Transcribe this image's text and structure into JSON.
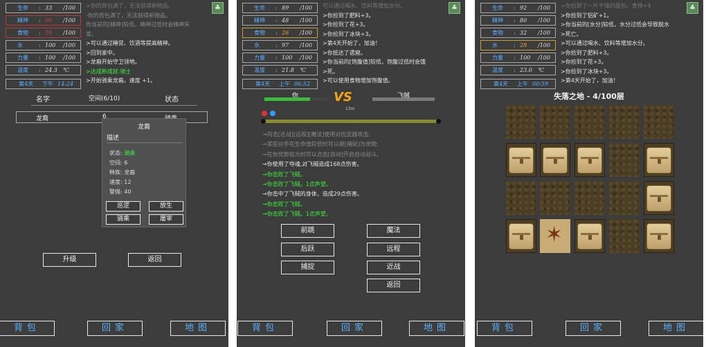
{
  "status": {
    "hp_label": "生命",
    "fresh_label": "精神",
    "food_label": "食物",
    "water_label": "水",
    "str_label": "力量",
    "temp_label": "温度",
    "sep": ":",
    "max": "/100",
    "deg": "℃"
  },
  "panel1": {
    "hp": "33",
    "fresh": "00",
    "food": "10",
    "water": "100",
    "str": "100",
    "temp": "24.3",
    "day": "第4天",
    "tod": "下午",
    "clock": "14:24",
    "log": [
      ">你的背包满了，无法获得新物品。",
      "-你的背包满了，无法获得新物品。",
      "你当前的[精神]较低，精神过低时会精神失",
      "常。",
      ">可以通过睡觉、饮酒等提高精神。",
      ">回到家中。",
      ">龙裔开始守卫领地。",
      ">达成新成就:骑士",
      ">开始骑乘龙裔。速度 +1。"
    ],
    "table_headers": {
      "name": "名字",
      "space": "空间(6/10)",
      "state": "状态"
    },
    "row": {
      "name": "龙裔",
      "space": "6",
      "state": "骑乘"
    },
    "popup": {
      "title": "龙裔",
      "desc": "描述",
      "state_k": "状态:",
      "state_v": "骑乘",
      "space_k": "空间:",
      "space_v": "6",
      "kind_k": "种族:",
      "kind_v": "龙裔",
      "speed_k": "速度:",
      "speed_v": "12",
      "loyal_k": "警惕:",
      "loyal_v": "40",
      "b1": "巡逻",
      "b2": "放生",
      "b3": "骑乘",
      "b4": "屠宰"
    },
    "upgrade": "升级",
    "back": "返回"
  },
  "panel2": {
    "hp": "89",
    "fresh": "48",
    "food": "26",
    "water": "97",
    "str": "100",
    "temp": "21.8",
    "day": "第4天",
    "tod": "上午",
    "clock": "06:52",
    "log": [
      "可以通过喝水、饮料等增加水分。",
      ">你捡到了肥料+3。",
      ">你捡到了花+3。",
      ">你捡到了冰块+3。",
      ">第4天开始了，加油！",
      ">你抵达了遗窟。",
      ">你当前的[饱腹值]较低，饱腹过低时会饿",
      ">死。",
      ">可以使用食物增加饱腹值。"
    ],
    "you": "你",
    "enemy": "飞贼",
    "vs": "VS",
    "distance": "13m",
    "combat": [
      "→向击[近战][远程][魔法]使用对应武器攻击;",
      "→某些对手在生命值较低时可以被[捕捉]为宠物;",
      "→在你优势较大时可以点击[自动]开启自动战斗。",
      "→你使用了夺魂,对飞贼造成168点伤害。",
      "→你击败了飞贼。",
      "→你击败了飞贼。1点声望。",
      "→你击中了飞贼的身体，造成29点伤害。",
      "→你击败了飞贼。",
      "→你击败了飞贼。1点声望。"
    ],
    "actions": {
      "a1": "前跳",
      "a2": "魔法",
      "a3": "后跃",
      "a4": "远程",
      "a5": "捕捉",
      "a6": "近战",
      "a7": "返回"
    }
  },
  "panel3": {
    "hp": "92",
    "fresh": "80",
    "food": "32",
    "water": "28",
    "str": "100",
    "temp": "23.0",
    "day": "第4天",
    "tod": "上午",
    "clock": "00:59",
    "log": [
      ">你捡到了一片干燥的面包。食物+4",
      ">你捡到了铝矿+1。",
      ">你当前的[水分]较低，水分过低会导致脱水",
      ">死亡。",
      ">可以通过喝水、饮料等增加水分。",
      ">你捡到了肥料+3。",
      ">你捡到了花+3。",
      ">你捡到了冰块+3。",
      ">第4天开始了，加油！"
    ],
    "title": "失落之地 - 4/100层",
    "grid": [
      [
        "dirt",
        "dirt",
        "dirt",
        "dirt",
        "dirt"
      ],
      [
        "chest",
        "chest",
        "chest",
        "dirt",
        "chest"
      ],
      [
        "dirt",
        "dirt",
        "dirt",
        "dirt",
        "chest"
      ],
      [
        "chest",
        "trap",
        "chest",
        "dirt",
        "chest"
      ]
    ]
  },
  "bottom": {
    "bag": "背包",
    "home": "回家",
    "map": "地图"
  },
  "gear": "♣"
}
